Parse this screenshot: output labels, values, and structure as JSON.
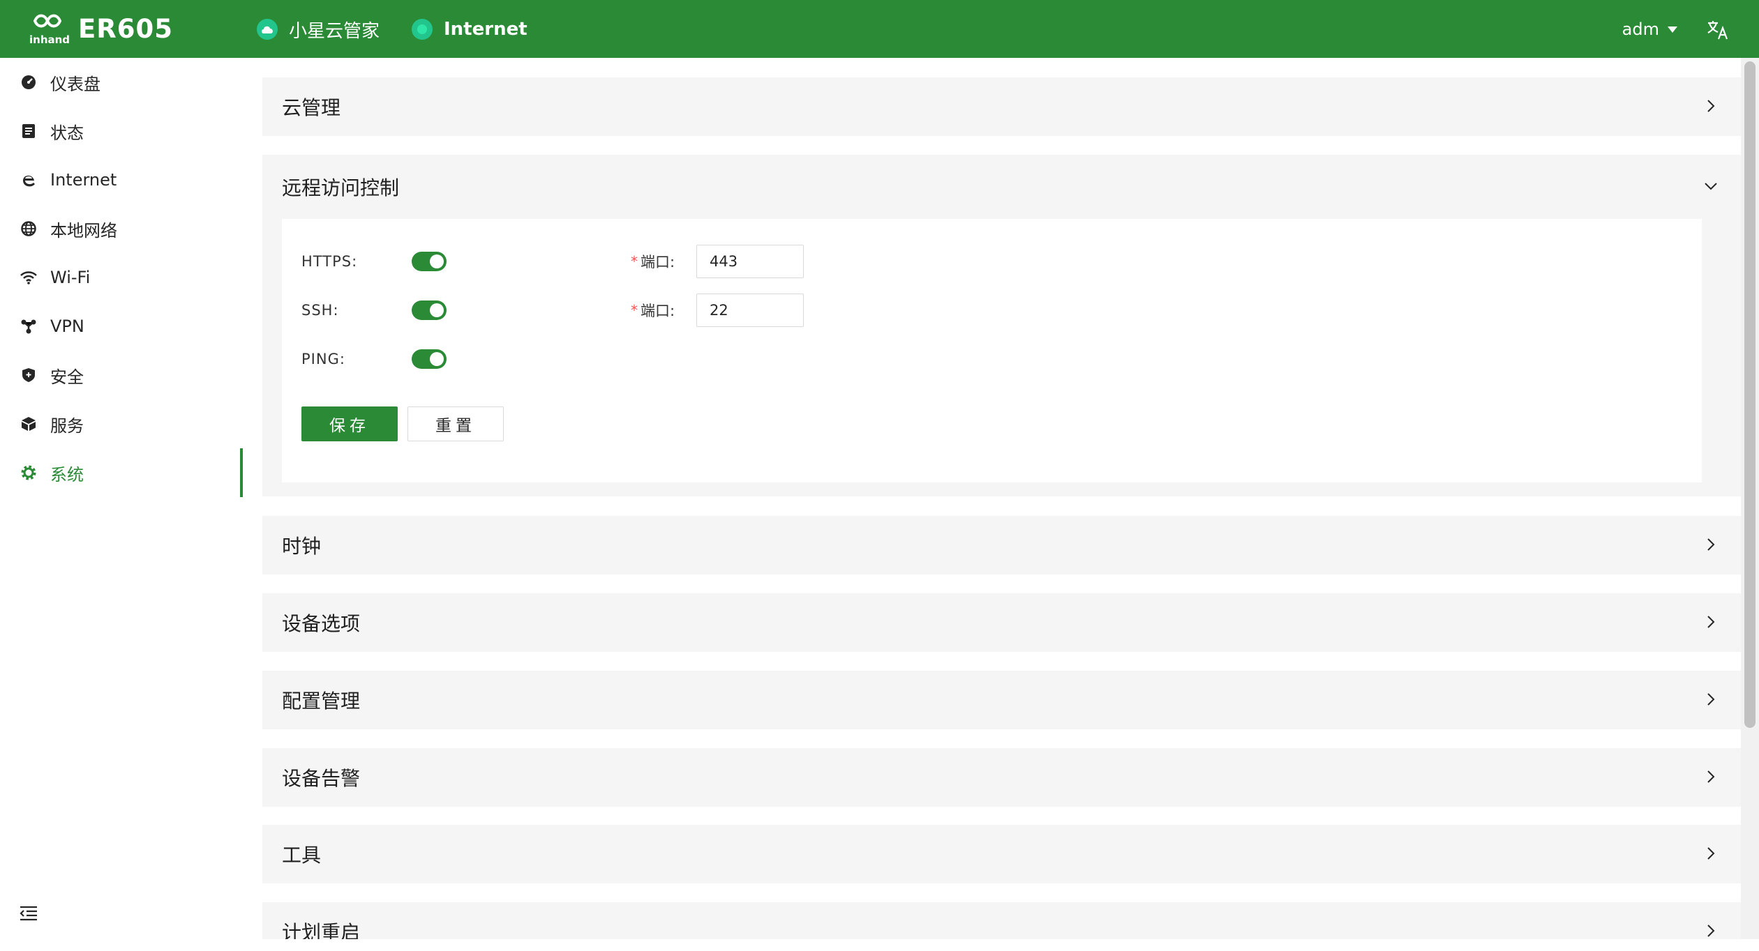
{
  "header": {
    "logo_text": "inhand",
    "model": "ER605",
    "cloud_status": "小星云管家",
    "internet_status": "Internet",
    "user": "adm",
    "colors": {
      "brand": "#2b8a36",
      "status_ok": "#22c58b"
    }
  },
  "sidebar": {
    "items": [
      {
        "label": "仪表盘",
        "icon": "dashboard-icon"
      },
      {
        "label": "状态",
        "icon": "status-list-icon"
      },
      {
        "label": "Internet",
        "icon": "internet-icon"
      },
      {
        "label": "本地网络",
        "icon": "globe-icon"
      },
      {
        "label": "Wi-Fi",
        "icon": "wifi-icon"
      },
      {
        "label": "VPN",
        "icon": "vpn-icon"
      },
      {
        "label": "安全",
        "icon": "shield-icon"
      },
      {
        "label": "服务",
        "icon": "cube-icon"
      },
      {
        "label": "系统",
        "icon": "gear-icon",
        "active": true
      }
    ]
  },
  "panels": {
    "cloud": {
      "title": "云管理"
    },
    "remote": {
      "title": "远程访问控制",
      "https_label": "HTTPS:",
      "ssh_label": "SSH:",
      "ping_label": "PING:",
      "https_enabled": true,
      "ssh_enabled": true,
      "ping_enabled": true,
      "port_label": "端口:",
      "https_port": "443",
      "ssh_port": "22",
      "save_label": "保存",
      "reset_label": "重置"
    },
    "clock": {
      "title": "时钟"
    },
    "device_options": {
      "title": "设备选项"
    },
    "config": {
      "title": "配置管理"
    },
    "alarm": {
      "title": "设备告警"
    },
    "tools": {
      "title": "工具"
    },
    "reboot": {
      "title": "计划重启"
    }
  }
}
